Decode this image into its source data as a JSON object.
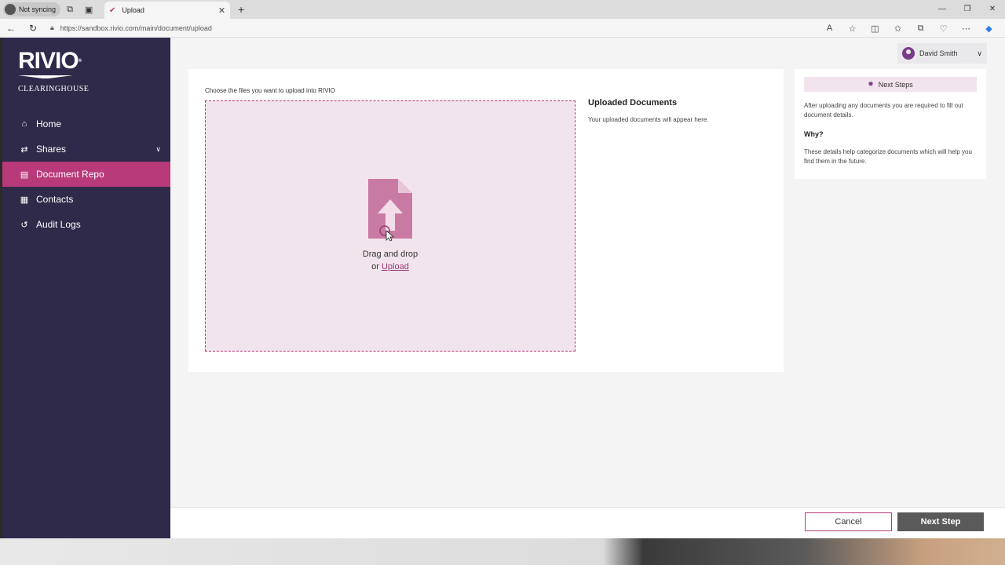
{
  "browser": {
    "profile_label": "Not syncing",
    "tab_title": "Upload",
    "url": "https://sandbox.rivio.com/main/document/upload"
  },
  "logo": {
    "brand": "RIVIO",
    "subtitle": "CLEARINGHOUSE"
  },
  "sidebar": {
    "items": [
      {
        "label": "Home",
        "icon": "home-icon"
      },
      {
        "label": "Shares",
        "icon": "shares-icon"
      },
      {
        "label": "Document Repo",
        "icon": "document-icon"
      },
      {
        "label": "Contacts",
        "icon": "contacts-icon"
      },
      {
        "label": "Audit Logs",
        "icon": "history-icon"
      }
    ],
    "active_index": 2
  },
  "user": {
    "name": "David Smith"
  },
  "upload": {
    "instruction": "Choose the files you want to upload into RIVIO",
    "drag_text": "Drag and drop",
    "or_text": "or ",
    "upload_link": "Upload"
  },
  "uploaded": {
    "title": "Uploaded Documents",
    "empty_text": "Your uploaded documents will appear here."
  },
  "next_steps": {
    "title": "Next Steps",
    "body": "After uploading any documents you are required to fill out document details.",
    "why_title": "Why?",
    "why_body": "These details help categorize documents which will help you find them in the future."
  },
  "footer": {
    "cancel_label": "Cancel",
    "next_label": "Next Step"
  },
  "colors": {
    "sidebar_bg": "#2f2a4a",
    "accent": "#b83a7a",
    "dropzone_bg": "#f2e4ec"
  }
}
